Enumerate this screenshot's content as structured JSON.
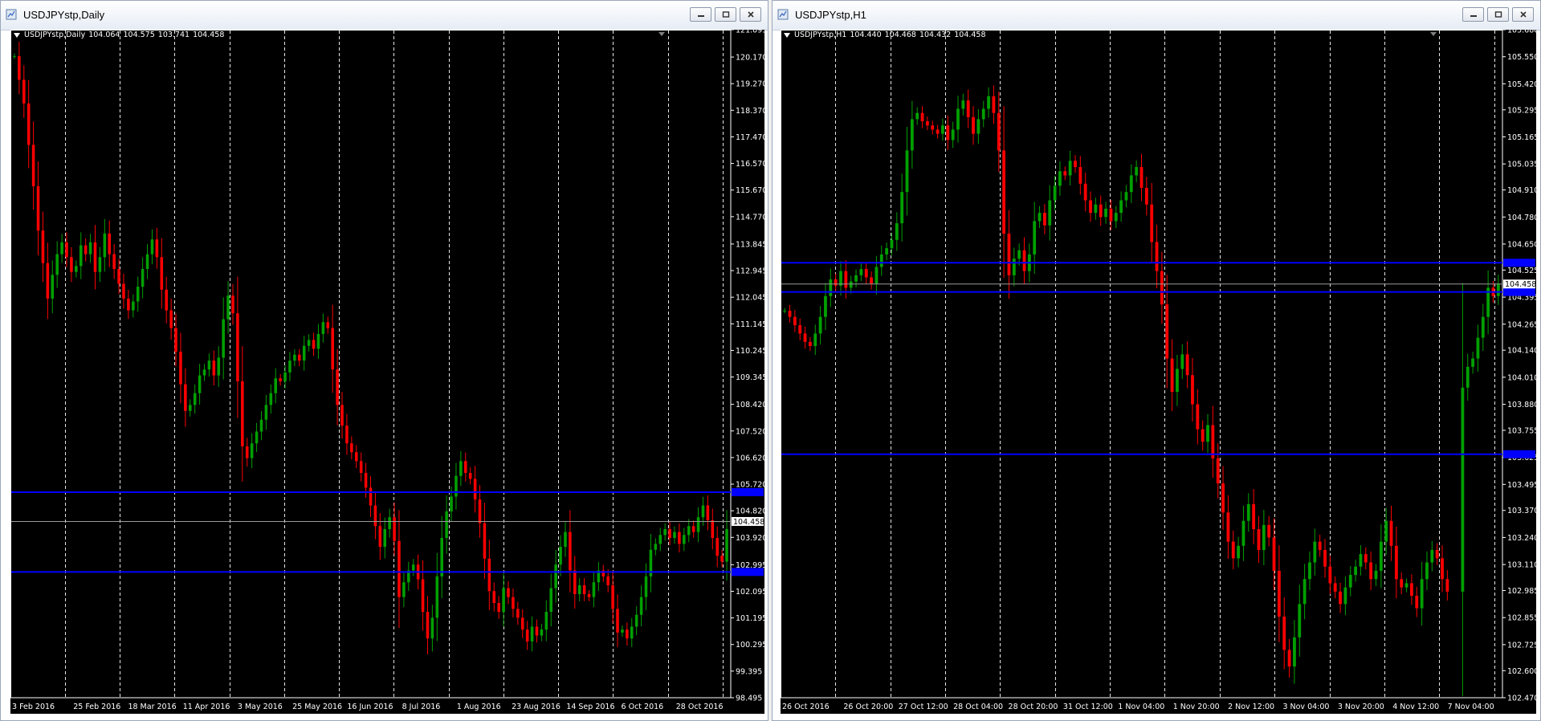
{
  "windows": [
    {
      "title": "USDJPYstp,Daily",
      "info": {
        "symbol": "USDJPYstp,Daily",
        "open": "104.064",
        "high": "104.575",
        "low": "103.741",
        "close": "104.458"
      }
    },
    {
      "title": "USDJPYstp,H1",
      "info": {
        "symbol": "USDJPYstp,H1",
        "open": "104.440",
        "high": "104.468",
        "low": "104.432",
        "close": "104.458"
      }
    }
  ],
  "chart_data": [
    {
      "type": "candlestick",
      "symbol": "USDJPYstp",
      "timeframe": "Daily",
      "ylim": [
        98.495,
        121.095
      ],
      "y_ticks": [
        "121.095",
        "120.170",
        "119.270",
        "118.370",
        "117.470",
        "116.570",
        "115.670",
        "114.770",
        "113.845",
        "112.945",
        "112.045",
        "111.145",
        "110.245",
        "109.345",
        "108.420",
        "107.520",
        "106.620",
        "105.720",
        "104.820",
        "103.920",
        "102.995",
        "102.095",
        "101.195",
        "100.295",
        "99.395",
        "98.495"
      ],
      "x_labels": [
        "3 Feb 2016",
        "25 Feb 2016",
        "18 Mar 2016",
        "11 Apr 2016",
        "3 May 2016",
        "25 May 2016",
        "16 Jun 2016",
        "8 Jul 2016",
        "1 Aug 2016",
        "23 Aug 2016",
        "14 Sep 2016",
        "6 Oct 2016",
        "28 Oct 2016"
      ],
      "current_price": "104.458",
      "levels": [
        105.45,
        102.75
      ],
      "grid": "vertical dashed",
      "colors": {
        "up": "#00a000",
        "down": "#ff0000",
        "level": "#0000ff",
        "price_line": "#9a9a9a"
      },
      "closes": [
        120.2,
        119.4,
        118.6,
        117.2,
        115.8,
        114.3,
        113.2,
        112.0,
        112.8,
        113.5,
        113.9,
        113.4,
        112.9,
        113.1,
        113.8,
        113.5,
        113.9,
        112.9,
        113.4,
        114.2,
        113.5,
        113.0,
        112.5,
        112.0,
        111.6,
        111.9,
        112.4,
        113.0,
        113.5,
        114.0,
        113.4,
        112.3,
        111.6,
        111.0,
        110.2,
        109.1,
        108.2,
        108.4,
        108.8,
        109.4,
        109.6,
        109.9,
        109.4,
        110.0,
        111.3,
        112.1,
        111.5,
        109.2,
        107.0,
        106.6,
        107.1,
        107.5,
        107.9,
        108.4,
        108.8,
        109.3,
        109.2,
        109.5,
        109.9,
        110.1,
        109.9,
        110.4,
        110.6,
        110.3,
        110.8,
        111.2,
        111.0,
        109.6,
        108.4,
        107.7,
        107.1,
        106.8,
        106.5,
        106.1,
        105.6,
        105.0,
        104.3,
        103.6,
        104.2,
        104.6,
        103.8,
        101.9,
        102.4,
        102.8,
        103.0,
        102.5,
        101.4,
        100.5,
        101.2,
        102.6,
        103.9,
        104.8,
        105.3,
        106.0,
        106.5,
        106.1,
        105.9,
        105.2,
        104.4,
        103.2,
        102.1,
        101.7,
        101.4,
        102.2,
        101.9,
        101.5,
        101.2,
        100.8,
        100.4,
        100.9,
        100.6,
        100.8,
        101.4,
        102.2,
        103.0,
        103.6,
        104.1,
        102.8,
        102.0,
        102.3,
        102.0,
        101.9,
        102.4,
        102.8,
        102.6,
        102.3,
        101.5,
        100.7,
        100.8,
        100.5,
        100.9,
        101.3,
        101.9,
        102.6,
        103.5,
        103.7,
        104.0,
        104.2,
        103.9,
        104.1,
        103.7,
        104.0,
        104.3,
        104.1,
        104.6,
        105.0,
        104.5,
        103.9,
        103.3,
        103.1,
        104.2
      ],
      "h1_price_ranges_note": ""
    },
    {
      "type": "candlestick",
      "symbol": "USDJPYstp",
      "timeframe": "H1",
      "ylim": [
        102.47,
        105.68
      ],
      "y_ticks": [
        "105.680",
        "105.550",
        "105.420",
        "105.295",
        "105.165",
        "105.035",
        "104.910",
        "104.780",
        "104.650",
        "104.525",
        "104.395",
        "104.265",
        "104.140",
        "104.010",
        "103.880",
        "103.755",
        "103.625",
        "103.495",
        "103.370",
        "103.240",
        "103.110",
        "102.985",
        "102.855",
        "102.725",
        "102.600",
        "102.470"
      ],
      "x_labels": [
        "26 Oct 2016",
        "26 Oct 20:00",
        "27 Oct 12:00",
        "28 Oct 04:00",
        "28 Oct 20:00",
        "31 Oct 12:00",
        "1 Nov 04:00",
        "1 Nov 20:00",
        "2 Nov 12:00",
        "3 Nov 04:00",
        "3 Nov 20:00",
        "4 Nov 12:00",
        "7 Nov 04:00"
      ],
      "current_price": "104.458",
      "levels": [
        104.56,
        104.42,
        103.64
      ],
      "grid": "vertical dashed",
      "colors": {
        "up": "#00a000",
        "down": "#ff0000",
        "level": "#0000ff",
        "price_line": "#9a9a9a"
      },
      "closes": [
        104.33,
        104.3,
        104.26,
        104.22,
        104.18,
        104.16,
        104.22,
        104.3,
        104.4,
        104.48,
        104.45,
        104.52,
        104.44,
        104.47,
        104.5,
        104.53,
        104.49,
        104.46,
        104.54,
        104.6,
        104.63,
        104.67,
        104.75,
        104.9,
        105.1,
        105.25,
        105.28,
        105.24,
        105.22,
        105.2,
        105.18,
        105.22,
        105.15,
        105.2,
        105.3,
        105.34,
        105.26,
        105.18,
        105.25,
        105.3,
        105.36,
        105.28,
        105.1,
        104.7,
        104.5,
        104.58,
        104.62,
        104.52,
        104.6,
        104.76,
        104.8,
        104.74,
        104.86,
        104.93,
        105.0,
        104.98,
        105.05,
        105.02,
        104.94,
        104.86,
        104.8,
        104.84,
        104.78,
        104.82,
        104.76,
        104.8,
        104.86,
        104.9,
        104.98,
        105.02,
        104.92,
        104.84,
        104.66,
        104.52,
        104.36,
        104.1,
        103.94,
        104.05,
        104.12,
        104.02,
        103.88,
        103.76,
        103.7,
        103.78,
        103.62,
        103.5,
        103.36,
        103.22,
        103.14,
        103.2,
        103.32,
        103.4,
        103.28,
        103.18,
        103.3,
        103.24,
        103.08,
        102.86,
        102.7,
        102.62,
        102.76,
        102.92,
        103.04,
        103.12,
        103.22,
        103.18,
        103.1,
        103.02,
        102.98,
        102.92,
        103.0,
        103.06,
        103.1,
        103.16,
        103.12,
        103.04,
        103.08,
        103.22,
        103.32,
        103.2,
        103.04,
        103.0,
        103.02,
        102.96,
        102.9,
        103.04,
        103.12,
        103.18,
        103.14,
        103.04,
        102.98,
        null,
        null,
        103.96,
        104.06,
        104.1,
        104.2,
        104.3,
        104.44,
        104.4,
        104.46
      ]
    }
  ]
}
